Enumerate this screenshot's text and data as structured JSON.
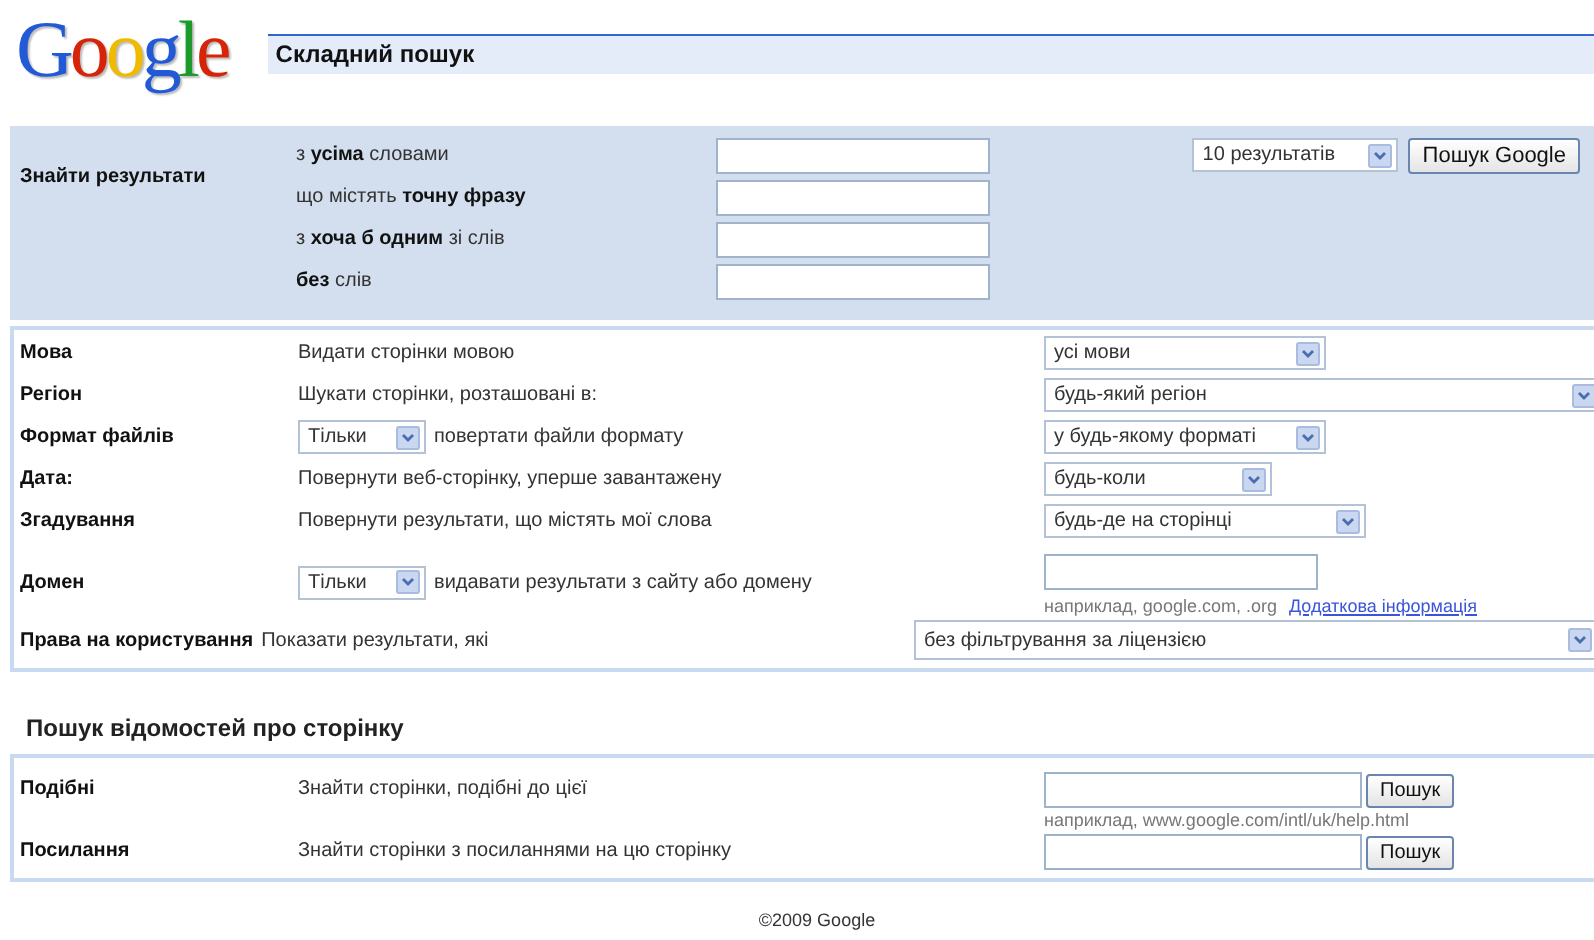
{
  "logo": "Google",
  "title": "Складний пошук",
  "find_results": {
    "label": "Знайти результати",
    "fields": [
      {
        "label": "з **усіма** словами"
      },
      {
        "label": "що містять **точну фразу**"
      },
      {
        "label": "з **хоча б одним** зі слів"
      },
      {
        "label": "**без** слів"
      }
    ],
    "results_per_page": "10 результатів",
    "search_button": "Пошук Google"
  },
  "options": [
    {
      "kind": "select",
      "label": "Мова",
      "description": "Видати сторінки мовою",
      "value": "усі мови"
    },
    {
      "kind": "select",
      "label": "Регіон",
      "description": "Шукати сторінки, розташовані в:",
      "value": "будь-який регіон"
    },
    {
      "kind": "select",
      "label": "Формат файлів",
      "prefix_select": "Тільки",
      "description": "повертати файли формату",
      "value": "у будь-якому форматі"
    },
    {
      "kind": "select",
      "label": "Дата:",
      "description": "Повернути веб-сторінку, уперше завантажену",
      "value": "будь-коли"
    },
    {
      "kind": "select",
      "label": "Згадування",
      "description": "Повернути результати, що містять мої слова",
      "value": "будь-де на сторінці"
    },
    {
      "kind": "input",
      "label": "Домен",
      "prefix_select": "Тільки",
      "description": "видавати результати з сайту або домену",
      "hint": "наприклад, google.com, .org",
      "link": "Додаткова інформація"
    },
    {
      "kind": "wide_select",
      "label": "Права на користування",
      "description": "Показати результати, які",
      "value": "без фільтрування за ліцензією"
    }
  ],
  "page_info": {
    "title": "Пошук відомостей про сторінку",
    "rows": [
      {
        "label": "Подібні",
        "description": "Знайти сторінки, подібні до цієї",
        "button": "Пошук",
        "hint": "наприклад, www.google.com/intl/uk/help.html"
      },
      {
        "label": "Посилання",
        "description": "Знайти сторінки з посиланнями на цю сторінку",
        "button": "Пошук"
      }
    ]
  },
  "footer": "©2009 Google"
}
